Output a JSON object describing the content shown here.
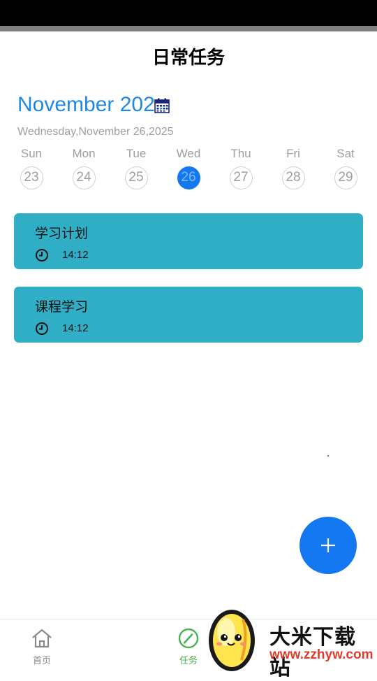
{
  "header": {
    "title": "日常任务"
  },
  "calendar": {
    "month_label": "November 2025",
    "date_line": "Wednesday,November 26,2025",
    "week": [
      {
        "name": "Sun",
        "num": "23"
      },
      {
        "name": "Mon",
        "num": "24"
      },
      {
        "name": "Tue",
        "num": "25"
      },
      {
        "name": "Wed",
        "num": "26",
        "selected": true
      },
      {
        "name": "Thu",
        "num": "27"
      },
      {
        "name": "Fri",
        "num": "28"
      },
      {
        "name": "Sat",
        "num": "29"
      }
    ]
  },
  "tasks": [
    {
      "name": "学习计划",
      "time": "14:12"
    },
    {
      "name": "课程学习",
      "time": "14:12"
    }
  ],
  "fab": {
    "icon": "plus-icon"
  },
  "bottom_nav": {
    "items": [
      {
        "label": "首页",
        "icon": "home-icon",
        "active": false
      },
      {
        "label": "任务",
        "icon": "edit-circle-icon",
        "active": true
      }
    ]
  },
  "watermark": {
    "title": "大米下载站",
    "url": "www.zzhyw.com"
  },
  "colors": {
    "accent": "#1478f0",
    "task_bg": "#30aec5",
    "nav_active": "#4caf50",
    "nav_inactive": "#8a8a8a"
  }
}
